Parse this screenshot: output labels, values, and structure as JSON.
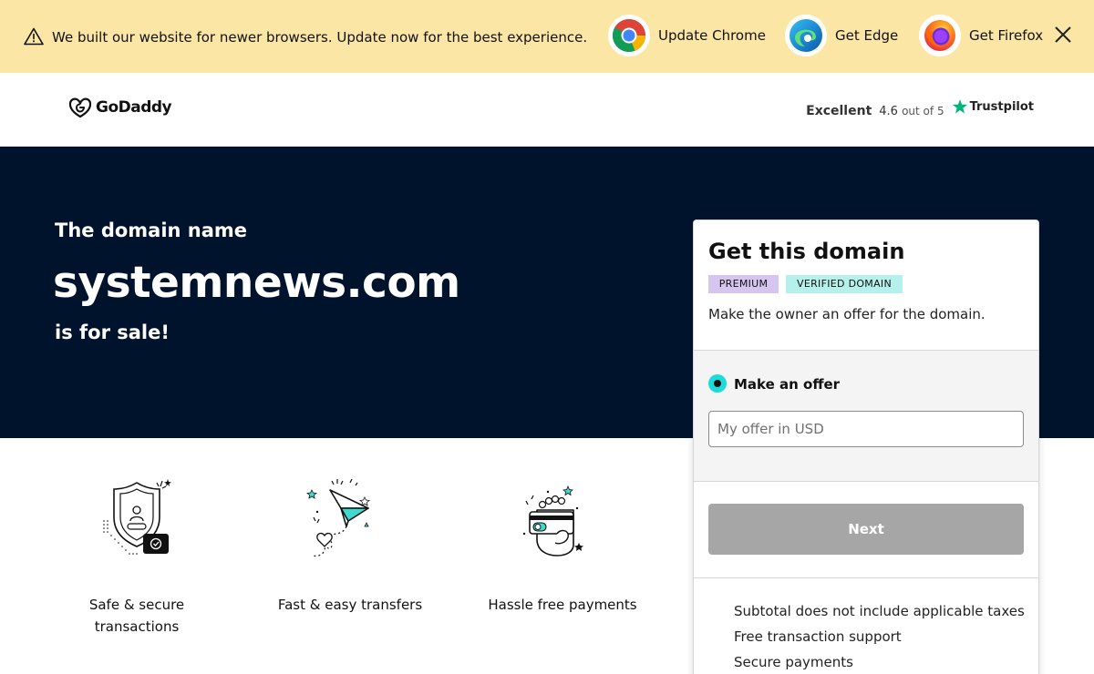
{
  "banner": {
    "message": "We built our website for newer browsers. Update now for the best experience.",
    "browsers": [
      {
        "label": "Update Chrome",
        "icon": "chrome-icon"
      },
      {
        "label": "Get Edge",
        "icon": "edge-icon"
      },
      {
        "label": "Get Firefox",
        "icon": "firefox-icon"
      }
    ],
    "close_icon": "close-icon"
  },
  "header": {
    "logo_text": "GoDaddy",
    "trustpilot": {
      "rating_word": "Excellent",
      "score": "4.6",
      "out_of": "out of 5",
      "brand": "Trustpilot"
    }
  },
  "hero": {
    "pre": "The domain name",
    "domain": "systemnews.com",
    "post": "is for sale!"
  },
  "features": [
    {
      "label_line1": "Safe & secure",
      "label_line2": "transactions",
      "icon": "shield-icon"
    },
    {
      "label_line1": "Fast & easy transfers",
      "label_line2": "",
      "icon": "paper-plane-icon"
    },
    {
      "label_line1": "Hassle free payments",
      "label_line2": "",
      "icon": "payment-card-icon"
    }
  ],
  "card": {
    "title": "Get this domain",
    "badges": [
      "PREMIUM",
      "VERIFIED DOMAIN"
    ],
    "description": "Make the owner an offer for the domain.",
    "offer_option": "Make an offer",
    "offer_placeholder": "My offer in USD",
    "next_label": "Next",
    "info": [
      "Subtotal does not include applicable taxes",
      "Free transaction support",
      "Secure payments"
    ]
  },
  "colors": {
    "banner_bg": "#fbe6a6",
    "hero_bg": "#00132d",
    "premium_badge": "#d6c6ef",
    "verified_badge": "#b6f0ea",
    "radio_accent": "#1bdbdb",
    "next_disabled": "#a6a6a6",
    "trustpilot_green": "#00b67a"
  }
}
